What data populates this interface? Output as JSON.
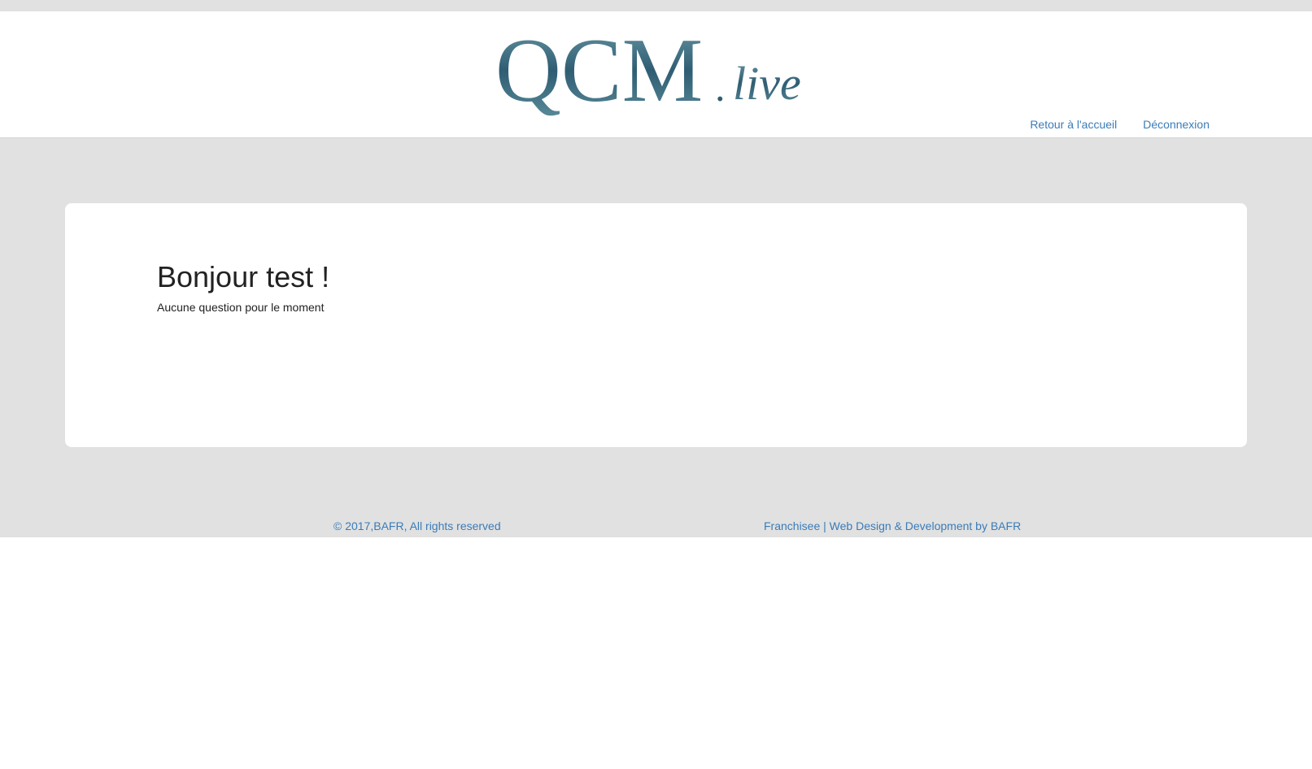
{
  "header": {
    "logo": {
      "main_text": "QCM",
      "dot": ".",
      "suffix_text": "live"
    },
    "nav": {
      "home_label": "Retour à l'accueil",
      "logout_label": "Déconnexion"
    }
  },
  "main": {
    "greeting": "Bonjour test !",
    "message": "Aucune question pour le moment"
  },
  "footer": {
    "copyright": "© 2017,BAFR, All rights reserved",
    "credits": "Franchisee | Web Design & Development by BAFR"
  },
  "colors": {
    "link": "#3a7cb8",
    "page_background": "#e1e1e1",
    "logo_gradient_start": "#2f5d73",
    "logo_gradient_end": "#6a9aa6"
  }
}
